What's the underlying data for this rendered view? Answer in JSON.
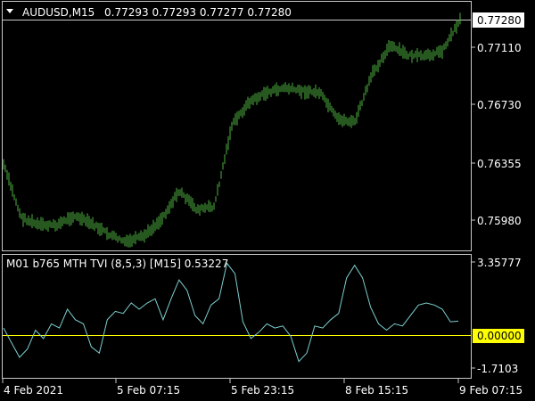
{
  "main_chart": {
    "collapse_icon": "triangle-down-icon",
    "symbol": "AUDUSD,M15",
    "ohlc": "0.77293 0.77293 0.77277 0.77280",
    "candle_color": "#4caf3f",
    "y_labels": [
      "0.77110",
      "0.76730",
      "0.76355",
      "0.75980"
    ],
    "current_price_label": "0.77280"
  },
  "indicator": {
    "title": "M01 b765 MTH TVI (8,5,3) [M15] 0.53227",
    "line_color": "#7ecfcf",
    "zero_line_color": "#ffff00",
    "y_labels": [
      "3.35777",
      "-1.7103"
    ],
    "zero_label": "0.00000"
  },
  "x_axis": {
    "labels": [
      "4 Feb 2021",
      "5 Feb 07:15",
      "5 Feb 23:15",
      "8 Feb 15:15",
      "9 Feb 07:15"
    ]
  },
  "chart_data": [
    {
      "type": "candlestick",
      "title": "AUDUSD,M15",
      "x": [
        "4 Feb 2021",
        "5 Feb 07:15",
        "5 Feb 23:15",
        "8 Feb 15:15",
        "9 Feb 07:15"
      ],
      "close_approx": [
        0.7635,
        0.7601,
        0.7596,
        0.7596,
        0.7602,
        0.7597,
        0.759,
        0.7585,
        0.7589,
        0.76,
        0.7618,
        0.7606,
        0.7608,
        0.766,
        0.7675,
        0.7681,
        0.7684,
        0.7682,
        0.7681,
        0.7664,
        0.7662,
        0.7693,
        0.7711,
        0.7705,
        0.7704,
        0.7708,
        0.7728
      ],
      "ylim": [
        0.7585,
        0.773
      ]
    },
    {
      "type": "line",
      "title": "M01 b765 MTH TVI (8,5,3) [M15] 0.53227",
      "ylim": [
        -1.7103,
        3.35777
      ],
      "values_approx": [
        0.2,
        -0.5,
        -1.2,
        -0.8,
        0.1,
        -0.3,
        0.4,
        0.2,
        1.1,
        0.6,
        0.4,
        -0.7,
        -1.0,
        0.6,
        1.0,
        0.9,
        1.4,
        1.1,
        1.4,
        1.6,
        0.6,
        1.6,
        2.5,
        2.0,
        0.8,
        0.4,
        1.3,
        1.6,
        3.3,
        2.8,
        0.5,
        -0.3,
        0.0,
        0.4,
        0.2,
        0.3,
        -0.2,
        -1.4,
        -1.0,
        0.3,
        0.2,
        0.6,
        0.9,
        2.6,
        3.2,
        2.6,
        1.2,
        0.4,
        0.1,
        0.4,
        0.3,
        0.8,
        1.3,
        1.4,
        1.3,
        1.1,
        0.5,
        0.53
      ]
    }
  ]
}
